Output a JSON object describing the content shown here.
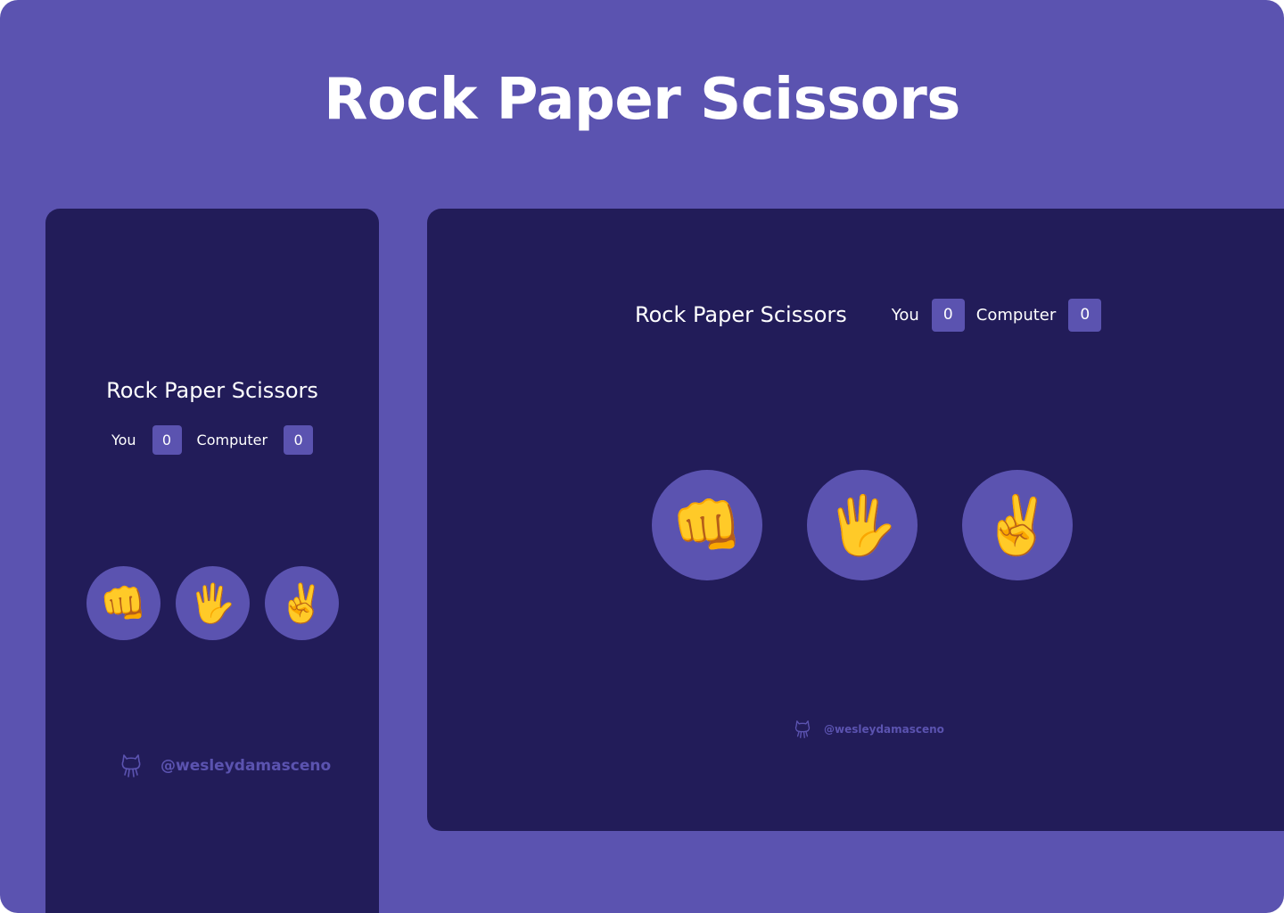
{
  "page": {
    "title": "Rock Paper Scissors"
  },
  "mobile": {
    "title": "Rock Paper Scissors",
    "you_label": "You",
    "you_score": "0",
    "computer_label": "Computer",
    "computer_score": "0",
    "choices": [
      {
        "name": "rock",
        "glyph": "👊"
      },
      {
        "name": "paper",
        "glyph": "🖐"
      },
      {
        "name": "scissors",
        "glyph": "✌"
      }
    ],
    "footer_handle": "@wesleydamasceno"
  },
  "desktop": {
    "title": "Rock Paper Scissors",
    "you_label": "You",
    "you_score": "0",
    "computer_label": "Computer",
    "computer_score": "0",
    "choices": [
      {
        "name": "rock",
        "glyph": "👊"
      },
      {
        "name": "paper",
        "glyph": "🖐"
      },
      {
        "name": "scissors",
        "glyph": "✌"
      }
    ],
    "footer_handle": "@wesleydamasceno"
  },
  "colors": {
    "background": "#5b53b0",
    "card": "#221c59",
    "accent": "#5b53b0",
    "text": "#ffffff"
  },
  "icons": {
    "footer": "github-icon"
  }
}
